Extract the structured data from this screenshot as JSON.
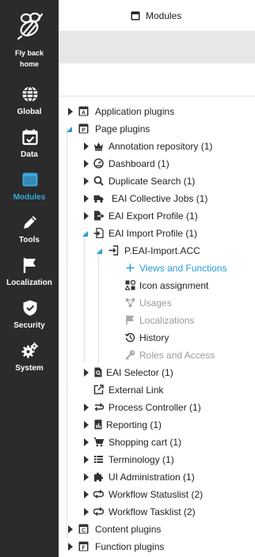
{
  "sidebar": {
    "brand_label": "Fly back\nhome",
    "items": [
      {
        "label": "Global",
        "icon": "globe-icon"
      },
      {
        "label": "Data",
        "icon": "calendar-check-icon"
      },
      {
        "label": "Modules",
        "icon": "window-icon",
        "active": true
      },
      {
        "label": "Tools",
        "icon": "pencil-icon"
      },
      {
        "label": "Localization",
        "icon": "flag-icon"
      },
      {
        "label": "Security",
        "icon": "shield-check-icon"
      },
      {
        "label": "System",
        "icon": "gears-icon"
      }
    ],
    "bg": "#2b2b2b",
    "active_color": "#38a9e0"
  },
  "header": {
    "title": "Modules",
    "icon": "window-icon"
  },
  "tree": {
    "items": [
      {
        "label": "Application plugins",
        "icon": "box-a-icon",
        "state": "collapsed"
      },
      {
        "label": "Page plugins",
        "icon": "box-p-icon",
        "state": "expanded"
      },
      {
        "label": "Annotation repository (1)",
        "icon": "crown-icon",
        "state": "collapsed"
      },
      {
        "label": "Dashboard (1)",
        "icon": "gauge-icon",
        "state": "collapsed"
      },
      {
        "label": "Duplicate Search (1)",
        "icon": "magnifier-icon",
        "state": "collapsed"
      },
      {
        "label": "EAI Collective Jobs (1)",
        "icon": "truck-icon",
        "state": "collapsed"
      },
      {
        "label": "EAI Export Profile (1)",
        "icon": "file-export-icon",
        "state": "collapsed"
      },
      {
        "label": "EAI Import Profile (1)",
        "icon": "file-import-icon",
        "state": "expanded"
      },
      {
        "label": "P.EAI-Import.ACC",
        "icon": "sign-in-icon",
        "state": "expanded"
      },
      {
        "label": "Views and Functions",
        "icon": "plus-icon",
        "state": "leaf",
        "style": "link"
      },
      {
        "label": "Icon assignment",
        "icon": "shapes-icon",
        "state": "leaf",
        "style": "normal"
      },
      {
        "label": "Usages",
        "icon": "share-nodes-icon",
        "state": "leaf",
        "style": "dim"
      },
      {
        "label": "Localizations",
        "icon": "flag-icon",
        "state": "leaf",
        "style": "dim"
      },
      {
        "label": "History",
        "icon": "history-icon",
        "state": "leaf",
        "style": "normal"
      },
      {
        "label": "Roles and Access",
        "icon": "key-icon",
        "state": "leaf",
        "style": "dim"
      },
      {
        "label": "EAI Selector (1)",
        "icon": "file-search-icon",
        "state": "collapsed"
      },
      {
        "label": "External Link",
        "icon": "external-link-icon",
        "state": "leaf"
      },
      {
        "label": "Process Controller (1)",
        "icon": "process-icon",
        "state": "collapsed"
      },
      {
        "label": "Reporting (1)",
        "icon": "report-icon",
        "state": "collapsed"
      },
      {
        "label": "Shopping cart (1)",
        "icon": "cart-icon",
        "state": "collapsed"
      },
      {
        "label": "Terminology (1)",
        "icon": "list-icon",
        "state": "collapsed"
      },
      {
        "label": "UI Administration (1)",
        "icon": "puzzle-icon",
        "state": "collapsed"
      },
      {
        "label": "Workflow Statuslist (2)",
        "icon": "workflow-icon",
        "state": "collapsed"
      },
      {
        "label": "Workflow Tasklist (2)",
        "icon": "workflow-icon",
        "state": "collapsed"
      },
      {
        "label": "Content plugins",
        "icon": "box-c-icon",
        "state": "collapsed"
      },
      {
        "label": "Function plugins",
        "icon": "box-f-icon",
        "state": "collapsed"
      }
    ],
    "arrow_color": "#333333",
    "expanded_arrow_color": "#2b9bd4",
    "link_color": "#2b9bd4",
    "dim_color": "#9a9a9a"
  }
}
